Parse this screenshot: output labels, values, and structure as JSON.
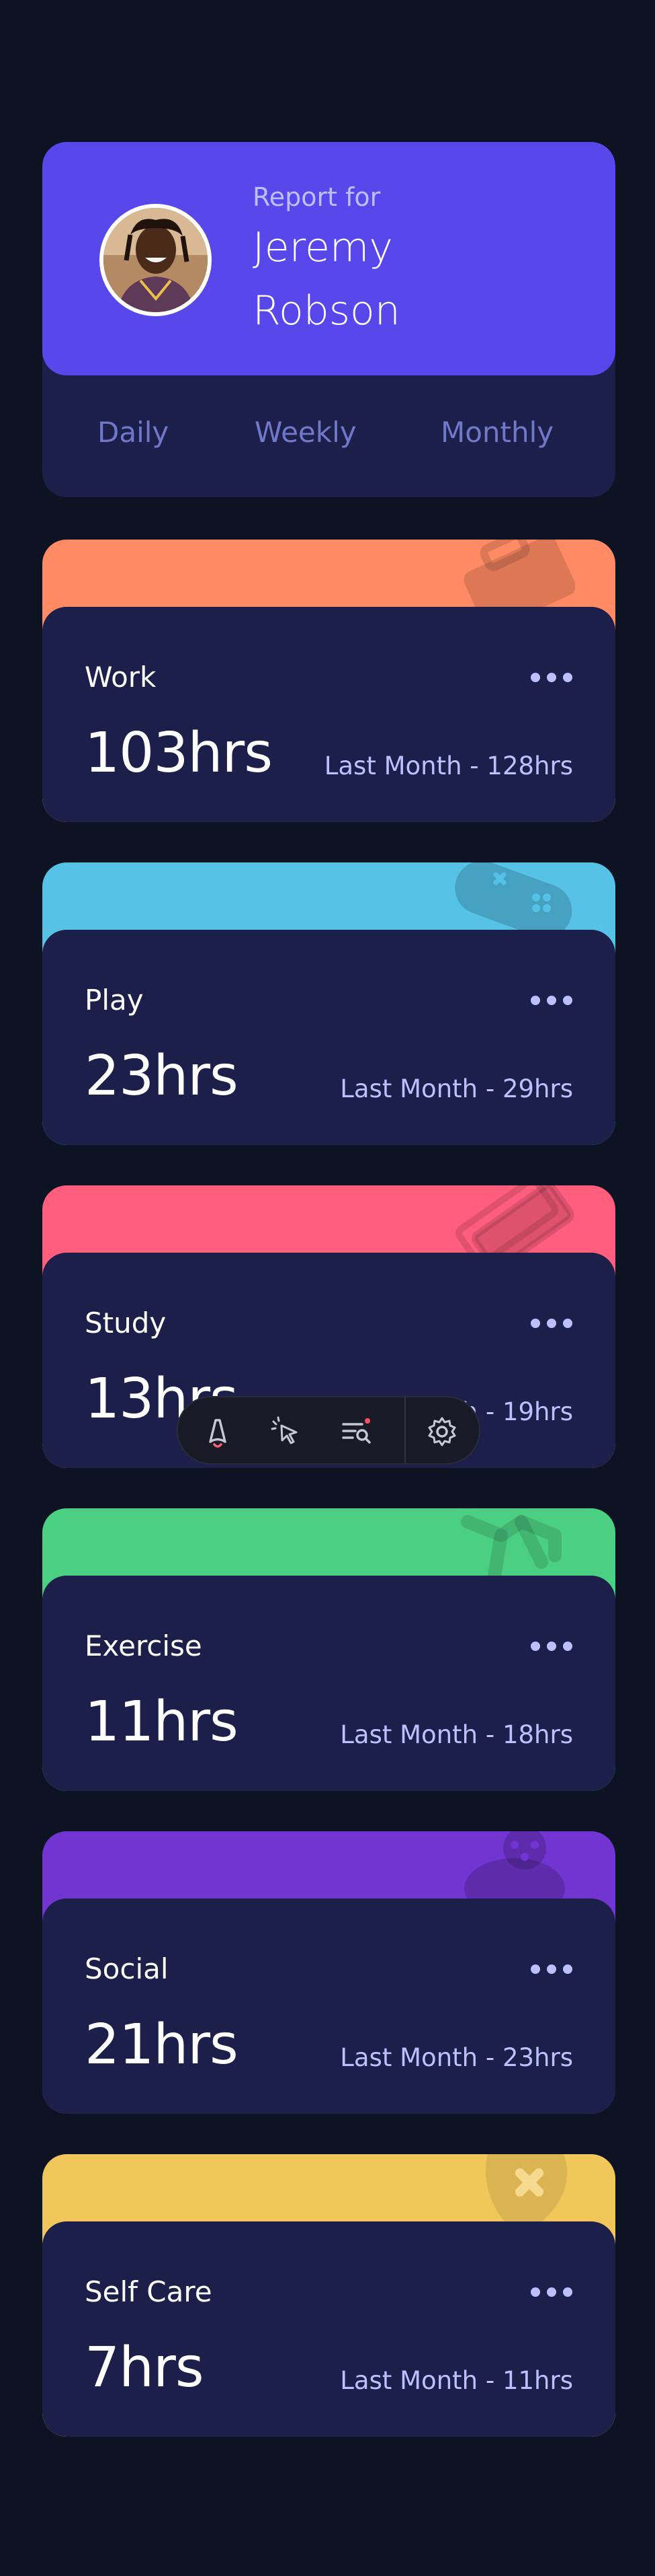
{
  "profile": {
    "report_label": "Report for",
    "name": "Jeremy Robson",
    "tabs": [
      "Daily",
      "Weekly",
      "Monthly"
    ]
  },
  "colors": {
    "background": "#0e1323",
    "card": "#1c1f4a",
    "profile_accent": "#5847eb",
    "muted_text": "#bbc0ff",
    "tab_text": "#7078c9"
  },
  "activities": [
    {
      "title": "Work",
      "current": "103hrs",
      "previous": "Last Month - 128hrs",
      "color": "#ff8b64",
      "icon": "briefcase-icon"
    },
    {
      "title": "Play",
      "current": "23hrs",
      "previous": "Last Month - 29hrs",
      "color": "#55c2e6",
      "icon": "gamepad-icon"
    },
    {
      "title": "Study",
      "current": "13hrs",
      "previous": "Last Month - 19hrs",
      "color": "#ff5e7d",
      "icon": "books-icon"
    },
    {
      "title": "Exercise",
      "current": "11hrs",
      "previous": "Last Month - 18hrs",
      "color": "#4bcf82",
      "icon": "runner-icon"
    },
    {
      "title": "Social",
      "current": "21hrs",
      "previous": "Last Month - 23hrs",
      "color": "#7335d2",
      "icon": "social-icon"
    },
    {
      "title": "Self Care",
      "current": "7hrs",
      "previous": "Last Month - 11hrs",
      "color": "#f1c75b",
      "icon": "heart-plus-icon"
    }
  ],
  "toolbar": {
    "icons": [
      "astro-logo-icon",
      "cursor-select-icon",
      "audit-list-icon",
      "gear-icon"
    ]
  }
}
